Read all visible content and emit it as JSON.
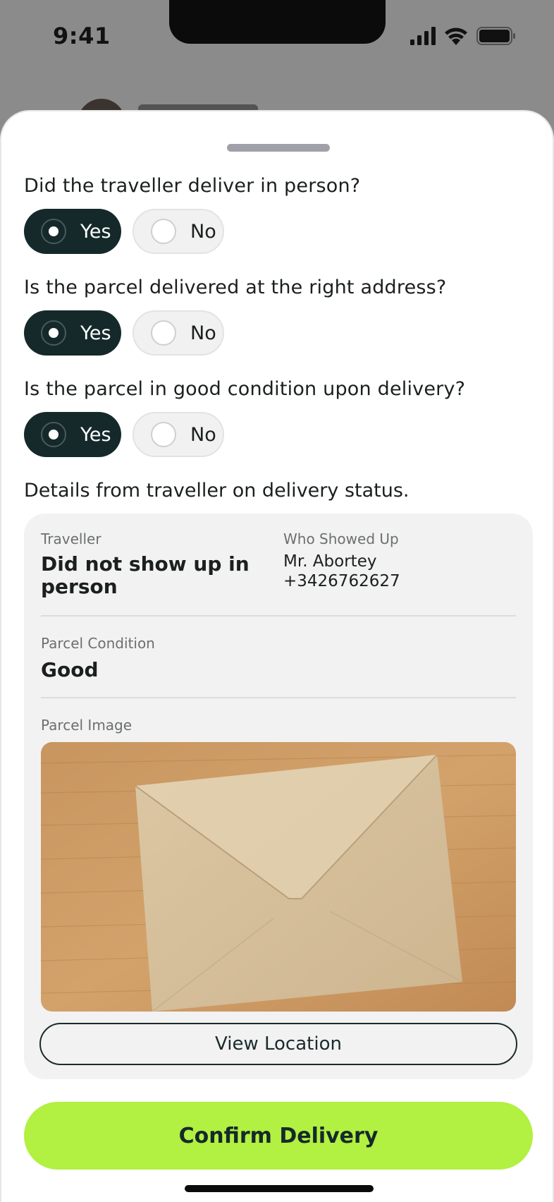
{
  "status_bar": {
    "time": "9:41"
  },
  "questions": [
    {
      "text": "Did the traveller deliver in person?",
      "options": [
        "Yes",
        "No"
      ],
      "selected": "Yes"
    },
    {
      "text": "Is the parcel delivered at the right address?",
      "options": [
        "Yes",
        "No"
      ],
      "selected": "Yes"
    },
    {
      "text": "Is the parcel in good condition upon delivery?",
      "options": [
        "Yes",
        "No"
      ],
      "selected": "Yes"
    }
  ],
  "details": {
    "title": "Details from traveller on delivery status.",
    "traveller_label": "Traveller",
    "traveller_value": "Did not show up in person",
    "who_label": "Who Showed Up",
    "who_name": "Mr. Abortey",
    "who_phone": "+3426762627",
    "condition_label": "Parcel Condition",
    "condition_value": "Good",
    "image_label": "Parcel Image",
    "view_location_label": "View Location"
  },
  "actions": {
    "confirm_label": "Confirm Delivery"
  },
  "colors": {
    "primary_dark": "#15292b",
    "accent_green": "#b2f041",
    "card_bg": "#f2f2f2",
    "backdrop": "#8b8b8b"
  }
}
